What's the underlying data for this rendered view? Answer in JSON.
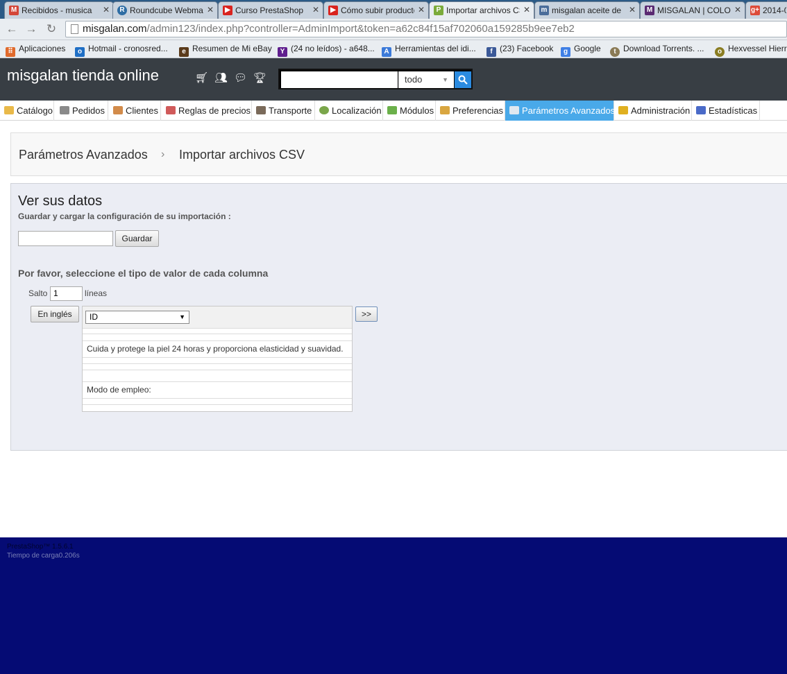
{
  "browser": {
    "tabs": [
      {
        "title": "Recibidos - musica",
        "icon": "gmail-icon",
        "color": "#d44638",
        "glyph": "M"
      },
      {
        "title": "Roundcube Webmail",
        "icon": "roundcube-icon",
        "color": "#2e6da4",
        "glyph": "R"
      },
      {
        "title": "Curso PrestaShop",
        "icon": "youtube-icon",
        "color": "#d9231e",
        "glyph": "▶"
      },
      {
        "title": "Cómo subir productos",
        "icon": "youtube-icon",
        "color": "#d9231e",
        "glyph": "▶"
      },
      {
        "title": "Importar archivos CSV",
        "icon": "prestashop-icon",
        "color": "#7bab3a",
        "glyph": "P",
        "active": true
      },
      {
        "title": "misgalan aceite de",
        "icon": "m-logo-icon",
        "color": "#4b6d9a",
        "glyph": "m"
      },
      {
        "title": "MISGALAN | COLONIAS",
        "icon": "shop-icon",
        "color": "#5a2a72",
        "glyph": "M"
      },
      {
        "title": "2014-0",
        "icon": "google-plus-icon",
        "color": "#dd4b39",
        "glyph": "g+"
      }
    ],
    "url_host": "misgalan.com",
    "url_path": "/admin123/index.php?controller=AdminImport&token=a62c84f15af702060a159285b9ee7eb2",
    "bookmarks": [
      {
        "label": "Aplicaciones",
        "icon": "apps-icon",
        "color": "#e06a2c",
        "glyph": "⠿"
      },
      {
        "label": "Hotmail - cronosred...",
        "icon": "outlook-icon",
        "color": "#1f6fc5",
        "glyph": "o"
      },
      {
        "label": "Resumen de Mi eBay",
        "icon": "ebay-icon",
        "color": "#5a3a1a",
        "glyph": "e"
      },
      {
        "label": "(24 no leídos) - a648...",
        "icon": "yahoo-icon",
        "color": "#5f1e8e",
        "glyph": "Y"
      },
      {
        "label": "Herramientas del idi...",
        "icon": "translate-icon",
        "color": "#3b7ad9",
        "glyph": "A"
      },
      {
        "label": "(23) Facebook",
        "icon": "facebook-icon",
        "color": "#3b5998",
        "glyph": "f"
      },
      {
        "label": "Google",
        "icon": "google-icon",
        "color": "#3f7fe5",
        "glyph": "g"
      },
      {
        "label": "Download Torrents. ...",
        "icon": "torrent-icon",
        "color": "#8a7a55",
        "glyph": "t"
      },
      {
        "label": "Hexvessel Hierro",
        "icon": "hexvessel-icon",
        "color": "#8a7d22",
        "glyph": "o"
      }
    ]
  },
  "header": {
    "shop_name": "misgalan tienda online",
    "search_placeholder": "",
    "search_scope": "todo"
  },
  "menu": [
    {
      "label": "Catálogo",
      "icon": "folder-icon",
      "color": "#e9b949"
    },
    {
      "label": "Pedidos",
      "icon": "cart-icon",
      "color": "#8a8a8a"
    },
    {
      "label": "Clientes",
      "icon": "user-icon",
      "color": "#d28b4a"
    },
    {
      "label": "Reglas de precios",
      "icon": "price-rules-icon",
      "color": "#d05a5a"
    },
    {
      "label": "Transporte",
      "icon": "truck-icon",
      "color": "#7a6a5a"
    },
    {
      "label": "Localización",
      "icon": "globe-icon",
      "color": "#7aa64a"
    },
    {
      "label": "Módulos",
      "icon": "puzzle-icon",
      "color": "#6bb04a"
    },
    {
      "label": "Preferencias",
      "icon": "preferences-icon",
      "color": "#d9a640"
    },
    {
      "label": "Parámetros Avanzados",
      "icon": "wrench-icon",
      "color": "#dfe8f0",
      "active": true
    },
    {
      "label": "Administración",
      "icon": "key-icon",
      "color": "#e0b020"
    },
    {
      "label": "Estadísticas",
      "icon": "bar-chart-icon",
      "color": "#4a6ac8"
    }
  ],
  "breadcrumb": {
    "parent": "Parámetros Avanzados",
    "separator": "›",
    "current": "Importar archivos CSV"
  },
  "content": {
    "title": "Ver sus datos",
    "save_config_label": "Guardar y cargar la configuración de su importación :",
    "config_name_value": "",
    "save_button": "Guardar",
    "select_type_heading": "Por favor, seleccione el tipo de valor de cada columna",
    "skip_label": "Salto",
    "skip_value": "1",
    "lines_label": "líneas",
    "english_button": "En inglés",
    "next_button": ">>",
    "column_type": "ID",
    "rows": [
      "",
      "",
      "Cuida y protege la piel 24 horas y proporciona elasticidad y suavidad.",
      "",
      "",
      "",
      "Modo de empleo:",
      "",
      ""
    ]
  },
  "footer": {
    "version": "PrestaShop™ 1.5.6.1",
    "load_time": "Tiempo de carga0.206s"
  }
}
